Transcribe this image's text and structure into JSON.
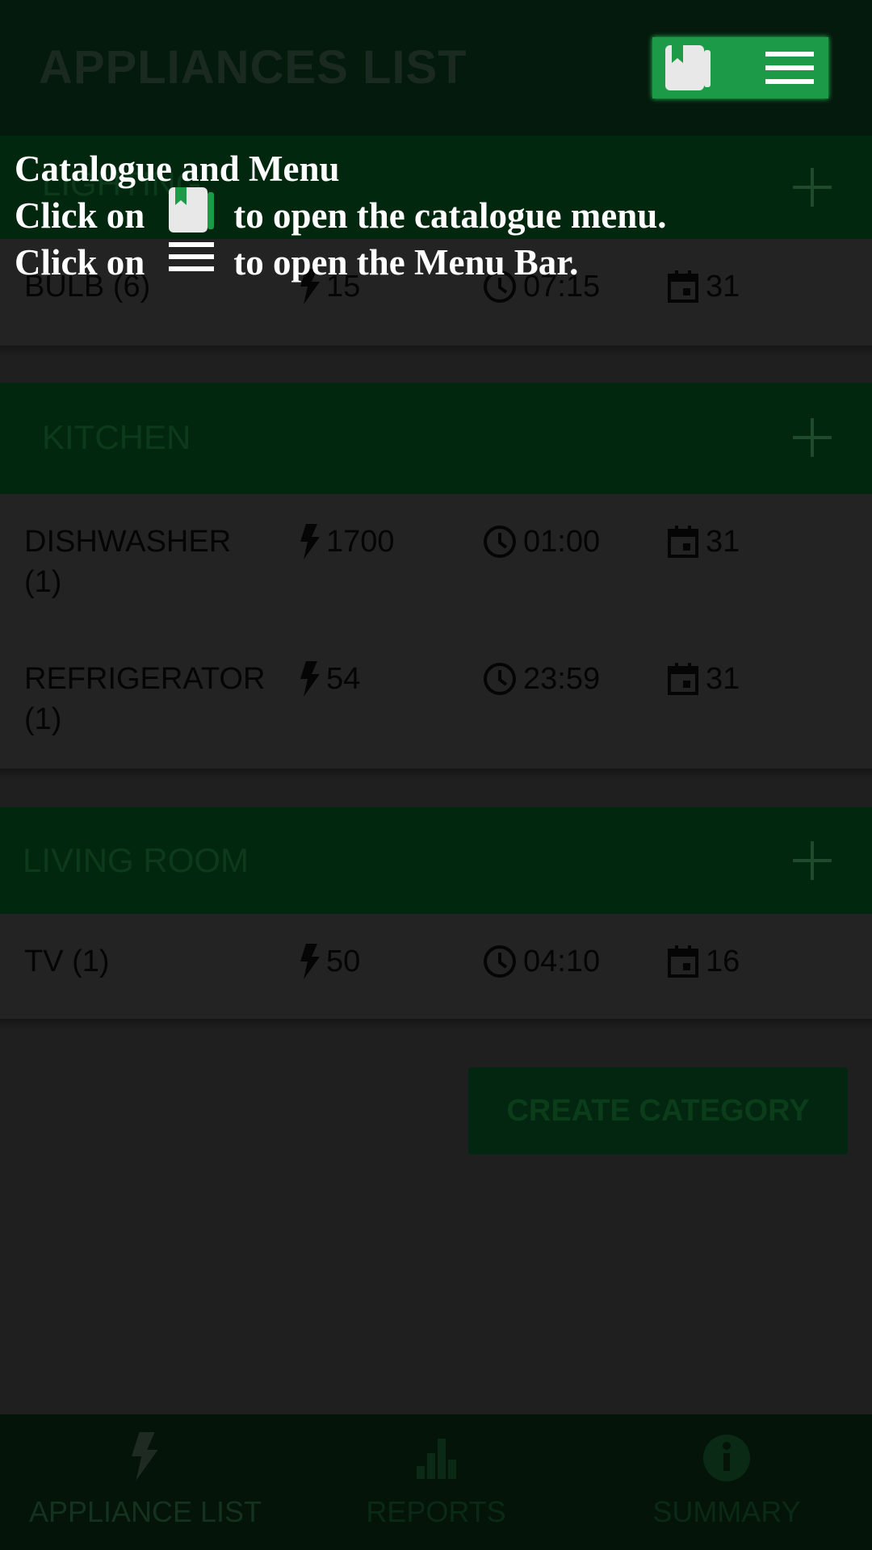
{
  "app_bar": {
    "title": "APPLIANCES LIST"
  },
  "categories": [
    {
      "title": "LIGHTING",
      "items": [
        {
          "name": "BULB (6)",
          "power": "15",
          "time": "07:15",
          "days": "31"
        }
      ]
    },
    {
      "title": "KITCHEN",
      "items": [
        {
          "name": "DISHWASHER (1)",
          "power": "1700",
          "time": "01:00",
          "days": "31"
        },
        {
          "name": "REFRIGERATOR (1)",
          "power": "54",
          "time": "23:59",
          "days": "31"
        }
      ]
    },
    {
      "title": "LIVING ROOM",
      "items": [
        {
          "name": "TV (1)",
          "power": "50",
          "time": "04:10",
          "days": "16"
        }
      ]
    }
  ],
  "create_button": "CREATE CATEGORY",
  "bottom_nav": [
    {
      "label": "APPLIANCE LIST",
      "icon": "bolt-icon",
      "active": true
    },
    {
      "label": "REPORTS",
      "icon": "bar-chart-icon",
      "active": false
    },
    {
      "label": "SUMMARY",
      "icon": "info-icon",
      "active": false
    }
  ],
  "tutorial": {
    "title": "Catalogue and Menu",
    "line1_prefix": "Click on",
    "line1_suffix": "to open the catalogue menu.",
    "line2_prefix": "Click on",
    "line2_suffix": "to open the Menu Bar."
  },
  "colors": {
    "accent": "#1d9a48",
    "overlay_text": "#ffffff"
  }
}
